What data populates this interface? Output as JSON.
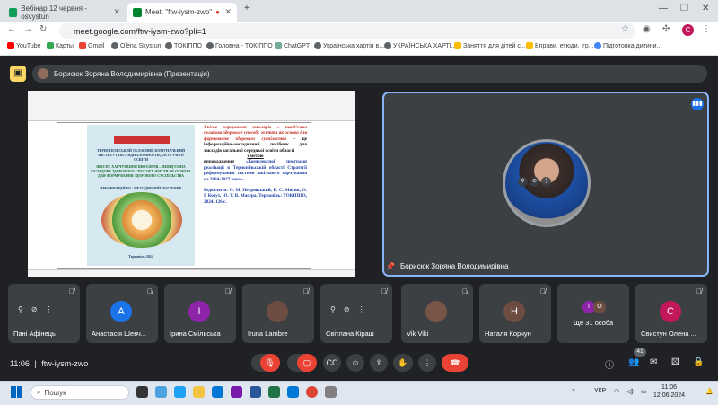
{
  "browser": {
    "tabs": [
      {
        "title": "Вебінар 12 червня - osvystun",
        "active": false
      },
      {
        "title": "Meet: \"ftw-iysm-zwo\"",
        "active": true
      }
    ],
    "new_tab": "+",
    "url": "meet.google.com/ftw-iysm-zwo?pli=1",
    "profile_initial": "C",
    "bookmarks": [
      "YouTube",
      "Карты",
      "Gmail",
      "Olena Skystun",
      "ТОКІППО",
      "Головна - ТОКІППО",
      "ChatGPT",
      "Українська хартія в...",
      "УКРАЇНСЬКА ХАРТІ...",
      "Заняття для дітей с...",
      "Вправи, етюди, ігр...",
      "Підготовка дитини..."
    ]
  },
  "meet": {
    "presenter_chip": "Борисюк Зоряна Володимирівна (Презентація)",
    "big_tile_name": "Борисюк Зоряна Володимирівна",
    "meeting_code": "ftw-iysm-zwo",
    "time": "11:06",
    "participant_count": "41",
    "participants": [
      {
        "name": "Пані Афінець",
        "initial": "",
        "color": "#5f6368"
      },
      {
        "name": "Анастасія Шевч...",
        "initial": "А",
        "color": "#1a73e8"
      },
      {
        "name": "Ірина Смільська",
        "initial": "І",
        "color": "#8e24aa"
      },
      {
        "name": "Iruna Lambre",
        "initial": "",
        "color": "#6d4c41"
      },
      {
        "name": "Світлана Кіраш",
        "initial": "",
        "color": "#5f6368"
      },
      {
        "name": "Vik Viki",
        "initial": "",
        "color": "#795548"
      },
      {
        "name": "Наталя Корчун",
        "initial": "Н",
        "color": "#6d4c41"
      },
      {
        "name": "Ще 31 особа",
        "initial": "",
        "color": "#5f6368"
      },
      {
        "name": "Свистун Олена ...",
        "initial": "С",
        "color": "#c2185b"
      }
    ],
    "more_initials": [
      "І",
      "О"
    ]
  },
  "slide": {
    "cover_org": "ТЕРНОПІЛЬСЬКИЙ ОБЛАСНИЙ КОМУНАЛЬНИЙ ІНСТИТУТ ПІСЛЯДИПЛОМНОЇ ПЕДАГОГІЧНОЇ ОСВІТИ",
    "cover_title": "ЯКІСНЕ ХАРЧУВАННЯ ШКОЛЯРІВ – НЕВІД'ЄМНА СКЛАДОВА ЗДОРОВОГО СПОСОБУ ЖИТТЯ ЯК ОСНОВА ДЛЯ ФОРМУВАННЯ ЗДОРОВОГО СУСПІЛЬСТВА",
    "cover_subtitle": "ІНФОРМАЦІЙНО - МЕТОДИЧНИЙ ПОСІБНИК",
    "cover_city": "Тернопіль 2024",
    "para1_red": "Якісне харчування школярів – невід'ємна складова здорового способу життя як основа для формування здорового суспільства",
    "para1_black": "– це інформаційно-методичний посібник для закладів загальної середньої освіти області",
    "with_purpose": "з метою",
    "para2_black": "впровадження",
    "para2_blue": "«Комплексної програми реалізації в Тернопільській області Стратегії реформування системи шкільного харчування на 2024-2027 роки»",
    "editors": "Редколегія: О. М. Петровський, В. С. Мисик, О. І. Когут, Ю. Т. В. Масера. Тернопіль: ТОКІППО, 2024. 126 с."
  },
  "taskbar": {
    "search_label": "Пошук",
    "lang": "УКР",
    "clock_time": "11:06",
    "clock_date": "12.06.2024"
  }
}
